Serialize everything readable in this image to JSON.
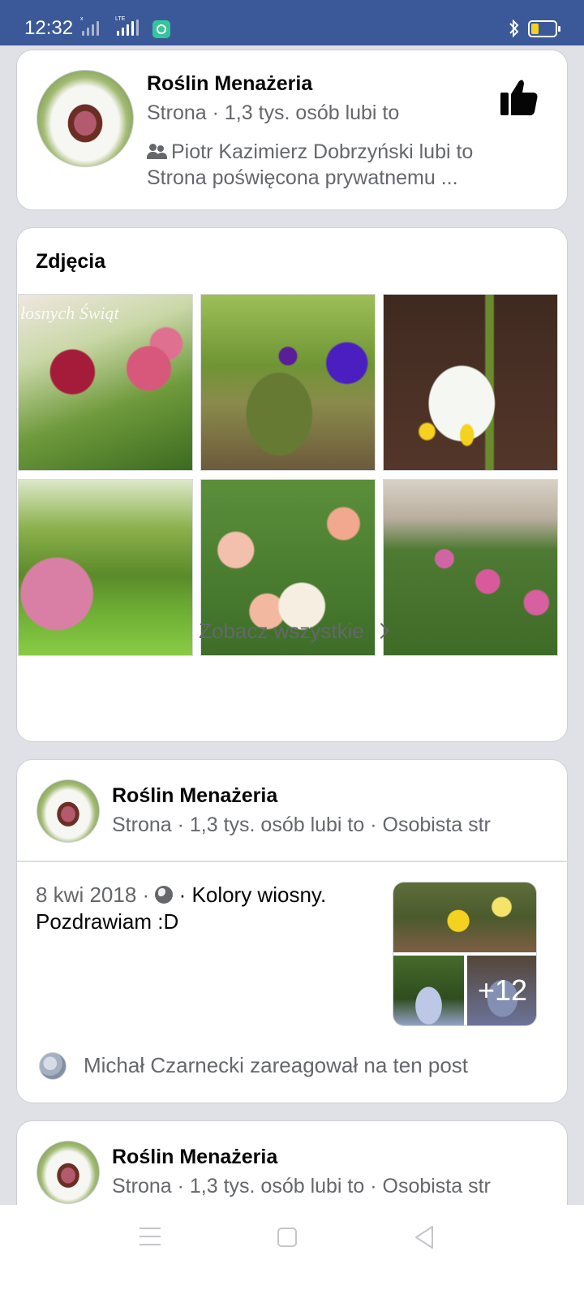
{
  "status_bar": {
    "time": "12:32",
    "sim1_label": "x",
    "sim2_label": "LTE",
    "bluetooth_icon": "bluetooth-icon",
    "battery_icon": "battery-low-icon",
    "colors": {
      "background": "#3b5998",
      "battery": "#f4d21f"
    }
  },
  "page_card": {
    "name": "Roślin Menażeria",
    "subtitle": "Strona · 1,3 tys. osób lubi to",
    "liked_by": "Piotr Kazimierz Dobrzyński lubi to",
    "description": "Strona poświęcona prywatnemu ...",
    "like_icon": "thumbs-up-icon"
  },
  "photos": {
    "title": "Zdjęcia",
    "overlay_text": "łosnych Świąt",
    "see_all": "Zobacz wszystkie",
    "items": [
      "hellebore-flowers",
      "purple-primroses",
      "snowflake-flower",
      "garden-path",
      "climbing-roses",
      "wild-violets"
    ]
  },
  "post1": {
    "name": "Roślin Menażeria",
    "subtitle": "Strona · 1,3 tys. osób lubi to · Osobista str",
    "date": "8 kwi 2018 · ",
    "text_line1": " · Kolory wiosny.",
    "text_line2": "Pozdrawiam :D",
    "more_photos": "+12",
    "reaction": "Michał Czarnecki zareagował na ten post"
  },
  "post2": {
    "name": "Roślin Menażeria",
    "subtitle": "Strona · 1,3 tys. osób lubi to · Osobista str"
  },
  "nav": {
    "menu_icon": "menu-icon",
    "home_icon": "home-icon",
    "back_icon": "back-icon"
  }
}
